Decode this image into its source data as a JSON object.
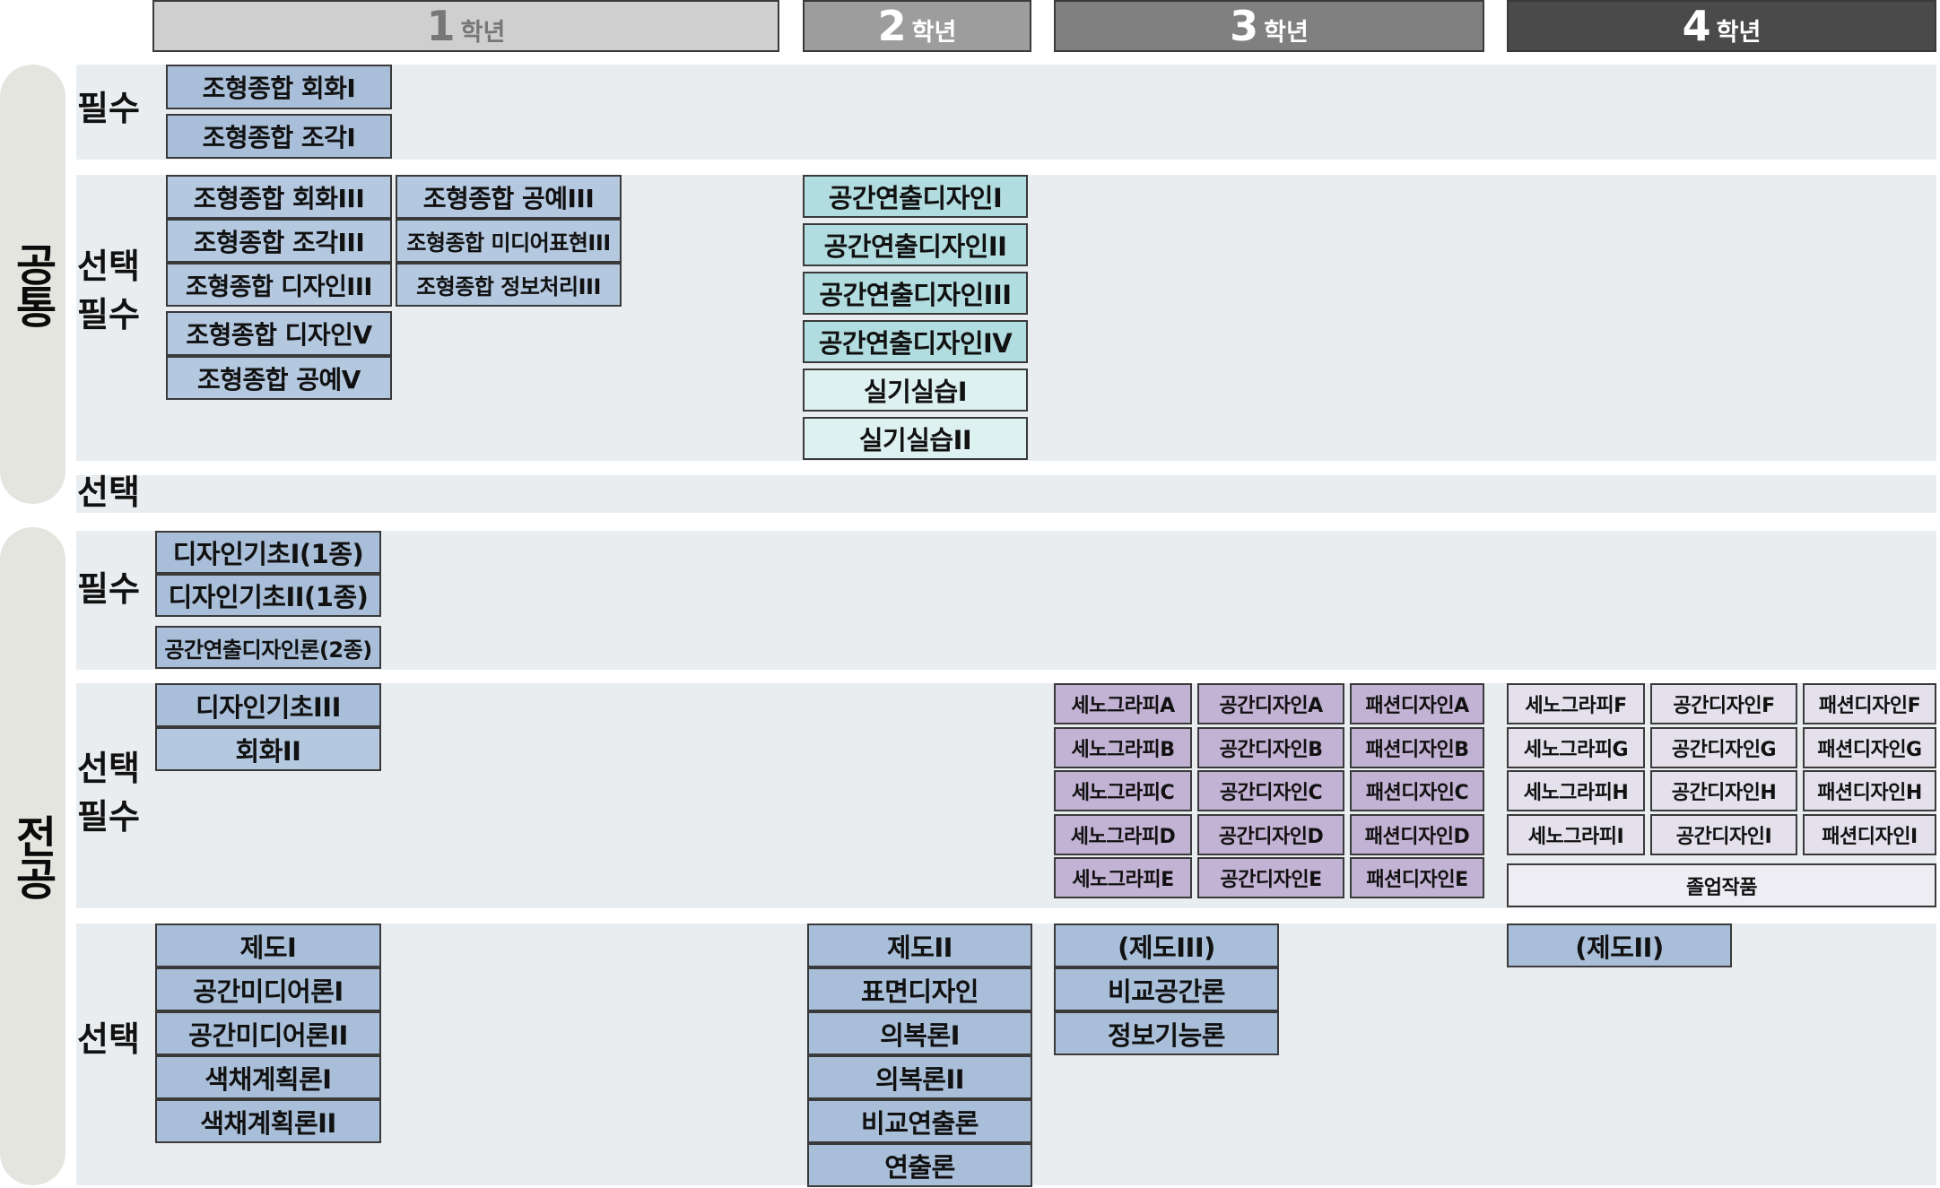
{
  "header": {
    "grade_word": "학년",
    "grades": [
      {
        "num": "1",
        "bg": "#cfcfcf",
        "fg": "#777777"
      },
      {
        "num": "2",
        "bg": "#9d9d9d",
        "fg": "#ffffff"
      },
      {
        "num": "3",
        "bg": "#808080",
        "fg": "#ffffff"
      },
      {
        "num": "4",
        "bg": "#4a4a4a",
        "fg": "#ffffff"
      }
    ]
  },
  "sections": {
    "common": {
      "title": "공통",
      "required": {
        "label": "필수",
        "y1": [
          "조형종합 회화I",
          "조형종합 조각I"
        ]
      },
      "elective_required": {
        "label": [
          "선택",
          "필수"
        ],
        "y1": {
          "col_a": [
            "조형종합 회화III",
            "조형종합 조각III",
            "조형종합 디자인III",
            "조형종합 디자인V",
            "조형종합 공예V"
          ],
          "col_b": [
            "조형종합 공예III",
            "조형종합 미디어표현III",
            "조형종합 정보처리III"
          ]
        },
        "y2": [
          "공간연출디자인I",
          "공간연출디자인II",
          "공간연출디자인III",
          "공간연출디자인IV",
          "실기실습I",
          "실기실습II"
        ]
      },
      "elective": {
        "label": "선택"
      }
    },
    "major": {
      "title": "전공",
      "required": {
        "label": "필수",
        "y1": [
          "디자인기초I(1종)",
          "디자인기초II(1종)",
          "공간연출디자인론(2종)"
        ]
      },
      "elective_required": {
        "label": [
          "선택",
          "필수"
        ],
        "y1": [
          "디자인기초III",
          "회화II"
        ],
        "y3": {
          "col_a": [
            "세노그라피A",
            "세노그라피B",
            "세노그라피C",
            "세노그라피D",
            "세노그라피E"
          ],
          "col_b": [
            "공간디자인A",
            "공간디자인B",
            "공간디자인C",
            "공간디자인D",
            "공간디자인E"
          ],
          "col_c": [
            "패션디자인A",
            "패션디자인B",
            "패션디자인C",
            "패션디자인D",
            "패션디자인E"
          ]
        },
        "y4": {
          "col_a": [
            "세노그라피F",
            "세노그라피G",
            "세노그라피H",
            "세노그라피I"
          ],
          "col_b": [
            "공간디자인F",
            "공간디자인G",
            "공간디자인H",
            "공간디자인I"
          ],
          "col_c": [
            "패션디자인F",
            "패션디자인G",
            "패션디자인H",
            "패션디자인I"
          ],
          "wide": "졸업작품"
        }
      },
      "elective": {
        "label": "선택",
        "y1": [
          "제도I",
          "공간미디어론I",
          "공간미디어론II",
          "색채계획론I",
          "색채계획론II"
        ],
        "y2": [
          "제도II",
          "표면디자인",
          "의복론I",
          "의복론II",
          "비교연출론",
          "연출론"
        ],
        "y3": [
          "(제도III)",
          "비교공간론",
          "정보기능론"
        ],
        "y4": [
          "(제도II)"
        ]
      }
    }
  }
}
